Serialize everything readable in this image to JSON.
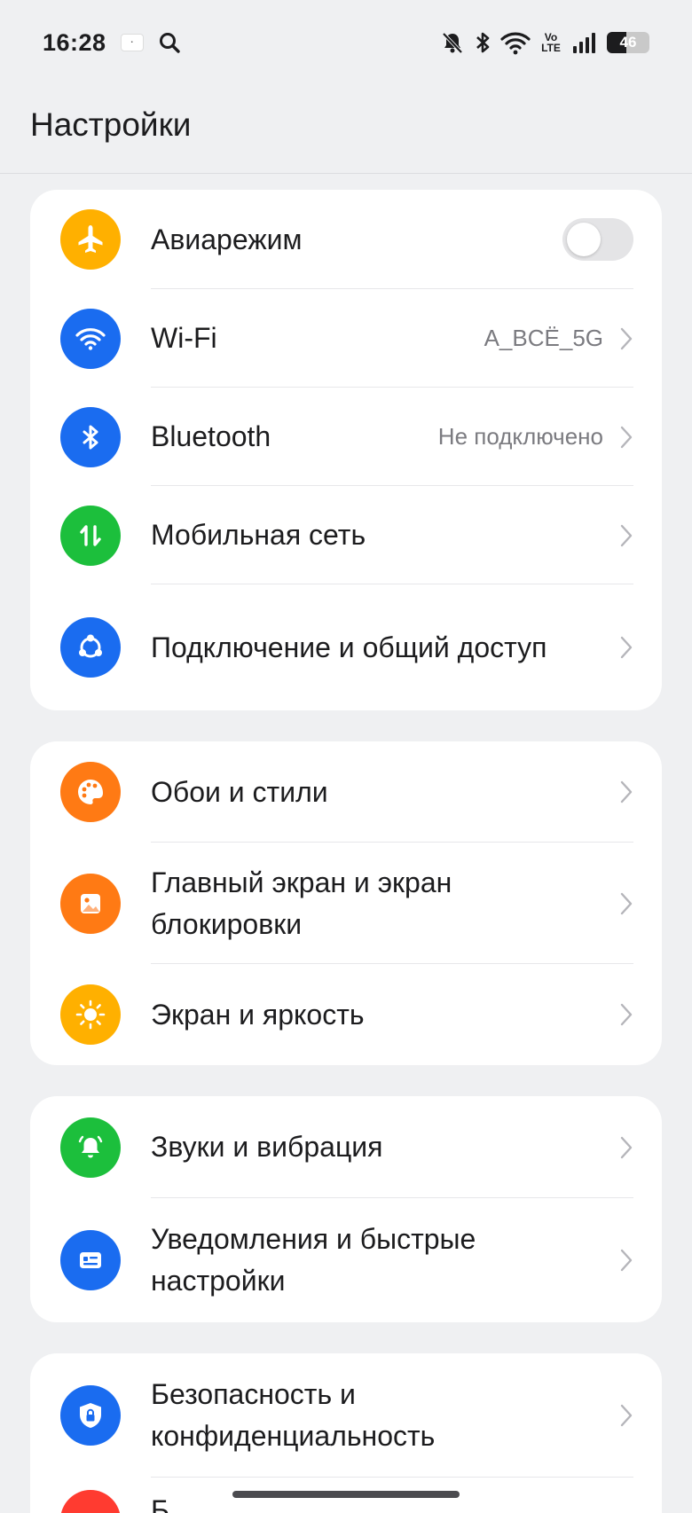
{
  "status_bar": {
    "time": "16:28",
    "battery_level": "46",
    "battery_fraction": 0.46,
    "network_badge_top": "Vo",
    "network_badge_bottom": "LTE",
    "icons": [
      "mute-bell-icon",
      "bluetooth-icon",
      "wifi-icon",
      "volte-icon",
      "signal-icon",
      "battery-icon"
    ]
  },
  "header": {
    "title": "Настройки"
  },
  "groups": [
    {
      "items": [
        {
          "label": "Авиарежим",
          "icon": "airplane-icon",
          "color": "#ffb000",
          "control": "toggle",
          "toggle_on": false
        },
        {
          "label": "Wi-Fi",
          "value": "A_BCЁ_5G",
          "icon": "wifi-icon",
          "color": "#1a6cf0"
        },
        {
          "label": "Bluetooth",
          "value": "Не подключено",
          "icon": "bluetooth-icon",
          "color": "#1a6cf0"
        },
        {
          "label": "Мобильная сеть",
          "icon": "mobile-data-icon",
          "color": "#1cbf3c"
        },
        {
          "label": "Подключение и общий доступ",
          "icon": "share-icon",
          "color": "#1a6cf0"
        }
      ]
    },
    {
      "items": [
        {
          "label": "Обои и стили",
          "icon": "palette-icon",
          "color": "#ff7a14"
        },
        {
          "label": "Главный экран и экран блокировки",
          "icon": "wallpaper-icon",
          "color": "#ff7a14"
        },
        {
          "label": "Экран и яркость",
          "icon": "brightness-icon",
          "color": "#ffb000"
        }
      ]
    },
    {
      "items": [
        {
          "label": "Звуки и вибрация",
          "icon": "bell-icon",
          "color": "#1cbf3c"
        },
        {
          "label": "Уведомления и быстрые настройки",
          "icon": "notification-card-icon",
          "color": "#1a6cf0"
        }
      ]
    },
    {
      "items": [
        {
          "label": "Безопасность и конфиденциальность",
          "icon": "shield-lock-icon",
          "color": "#1a6cf0"
        },
        {
          "label": "Б",
          "icon": "battery-settings-icon",
          "color": "#ff3b30"
        }
      ]
    }
  ]
}
